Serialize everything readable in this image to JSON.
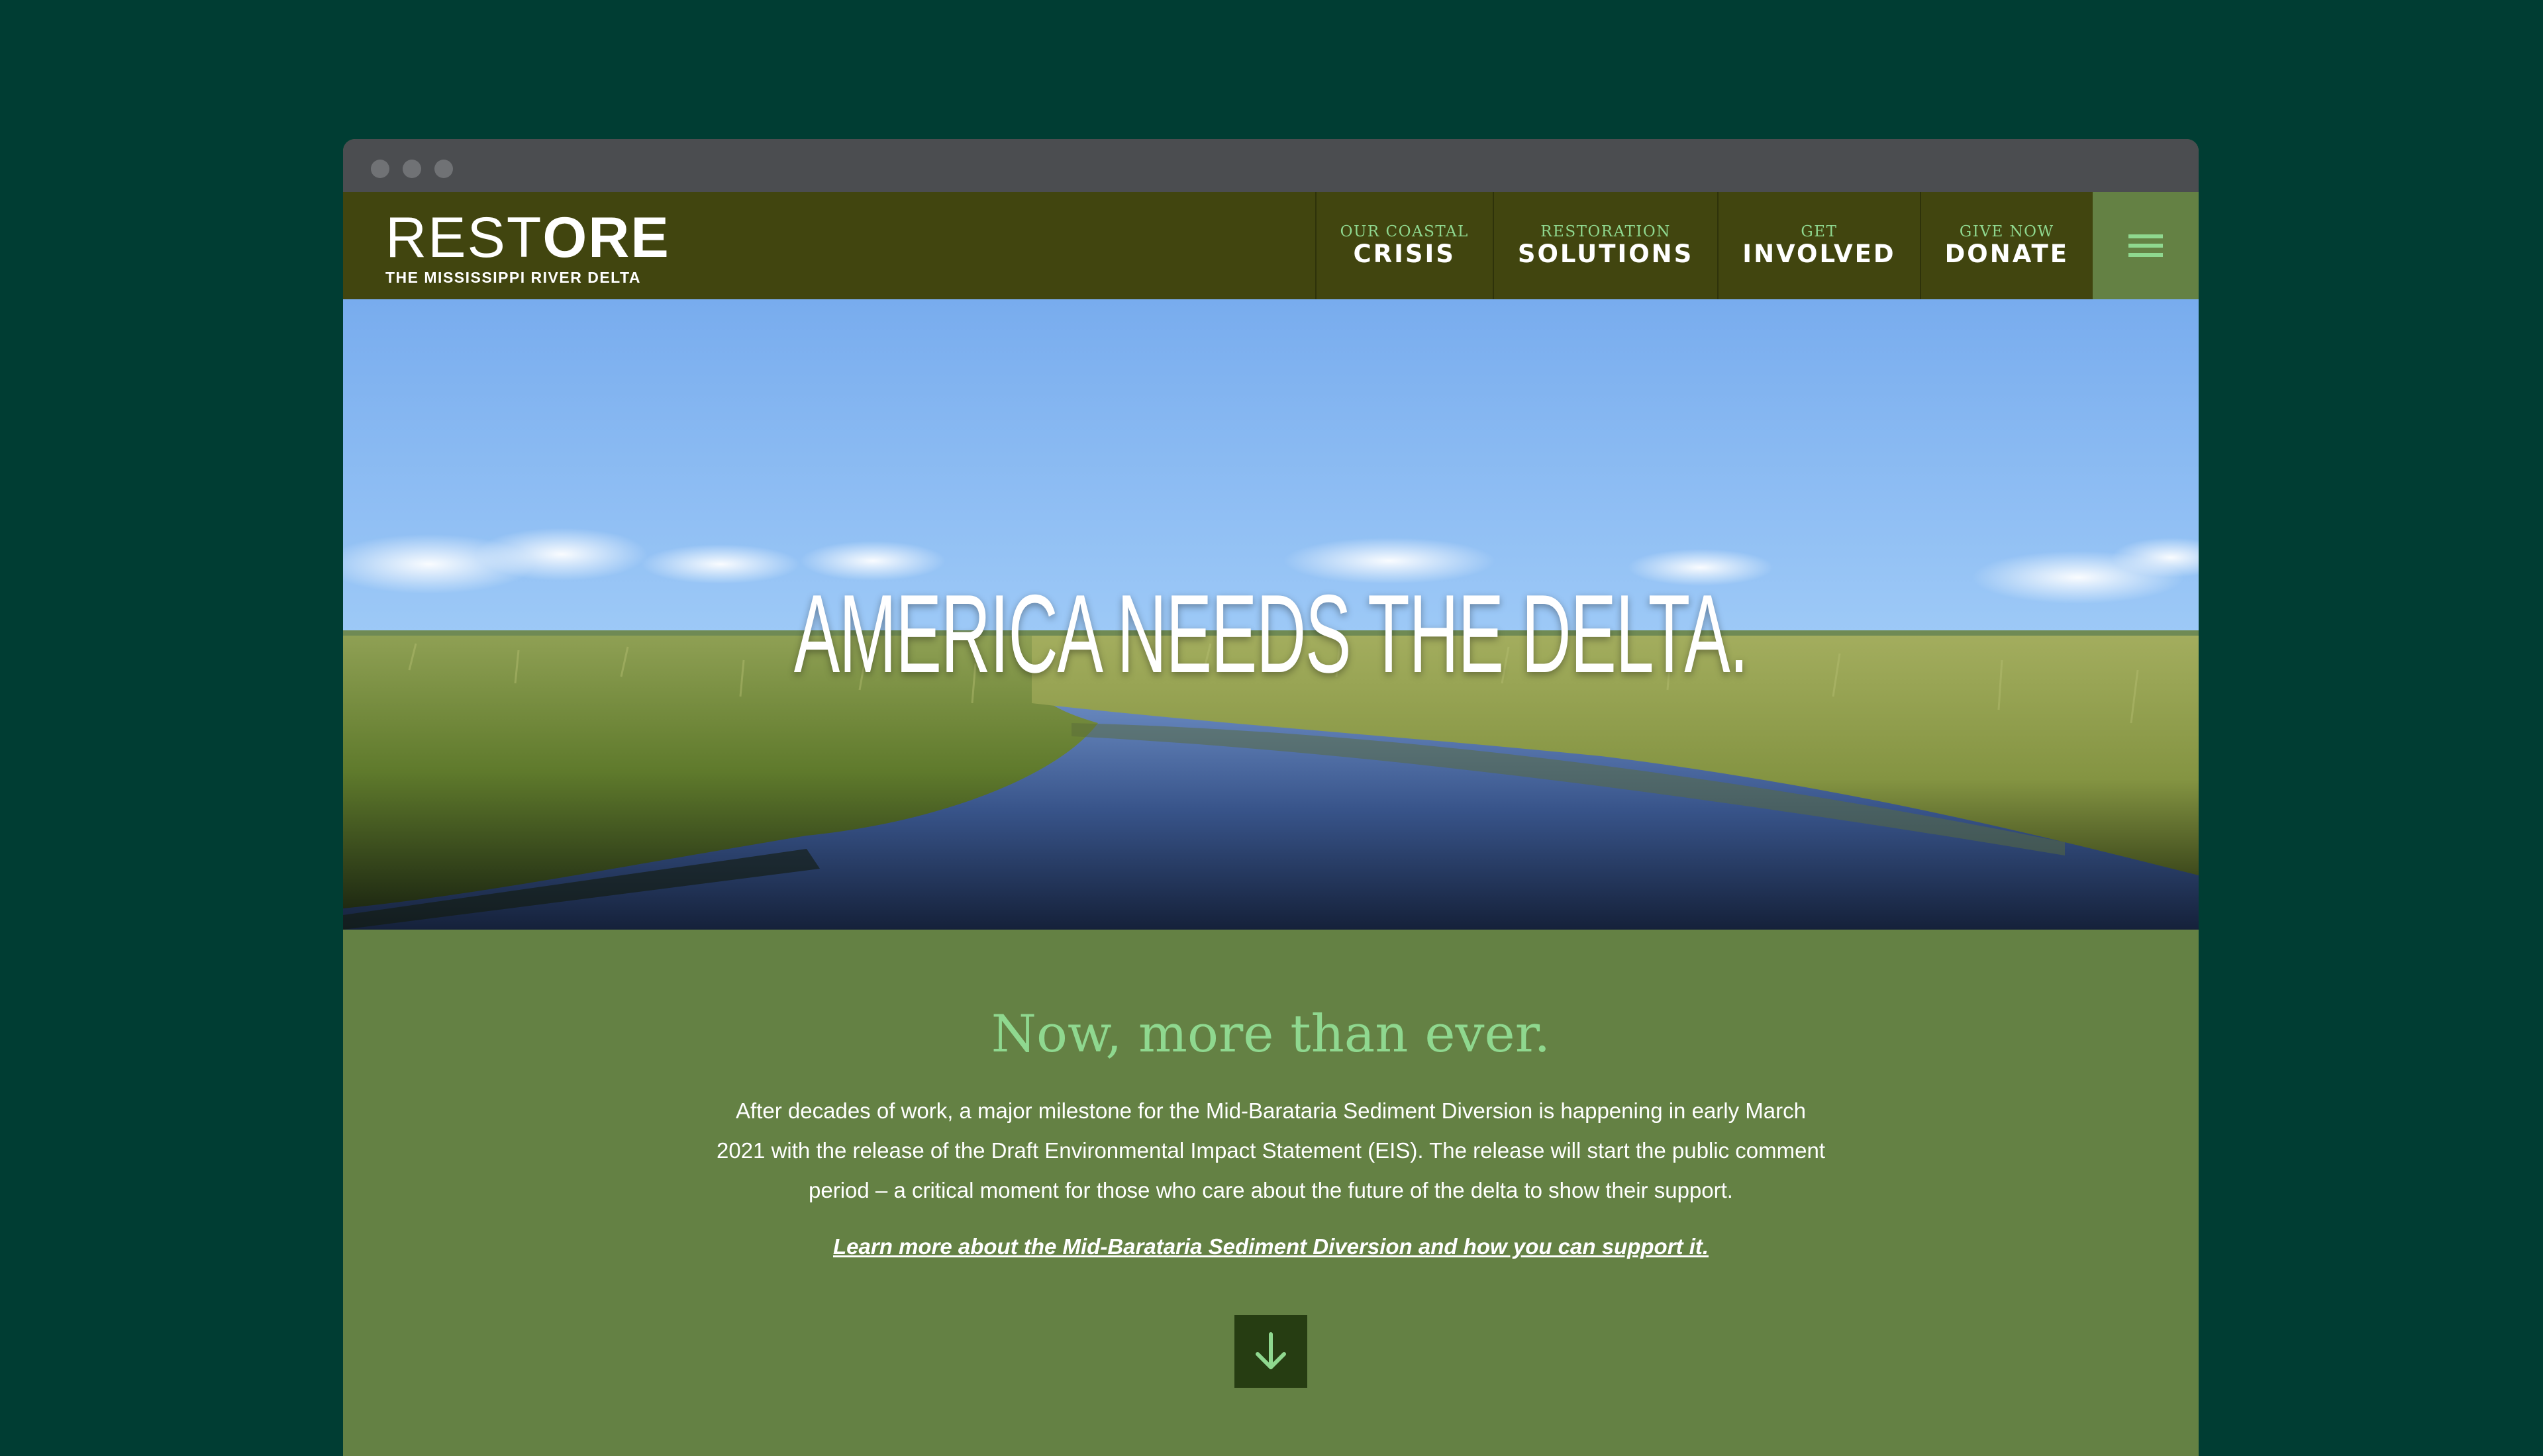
{
  "header": {
    "logo": {
      "word_light": "REST",
      "word_bold": "ORE",
      "tagline": "THE MISSISSIPPI RIVER DELTA"
    },
    "nav": [
      {
        "small": "OUR COASTAL",
        "big": "CRISIS"
      },
      {
        "small": "RESTORATION",
        "big": "SOLUTIONS"
      },
      {
        "small": "GET",
        "big": "INVOLVED"
      },
      {
        "small": "GIVE NOW",
        "big": "DONATE"
      }
    ],
    "menu_icon": "hamburger-icon"
  },
  "hero": {
    "title": "AMERICA NEEDS THE DELTA."
  },
  "intro": {
    "heading": "Now, more than ever.",
    "body": "After decades of work, a major milestone for the Mid-Barataria Sediment Diversion is happening in early March 2021 with the release of the Draft Environmental Impact Statement (EIS). The release will start the public comment period – a critical moment for those who care about the future of the delta to show their support.",
    "link": "Learn more about the Mid-Barataria Sediment Diversion and how you can support it.",
    "scroll_icon": "arrow-down-icon"
  },
  "colors": {
    "page_bg": "#003d33",
    "header_bg": "#41450f",
    "accent_green": "#8fd88f",
    "section_bg": "#648144",
    "button_dark": "#263d12"
  }
}
